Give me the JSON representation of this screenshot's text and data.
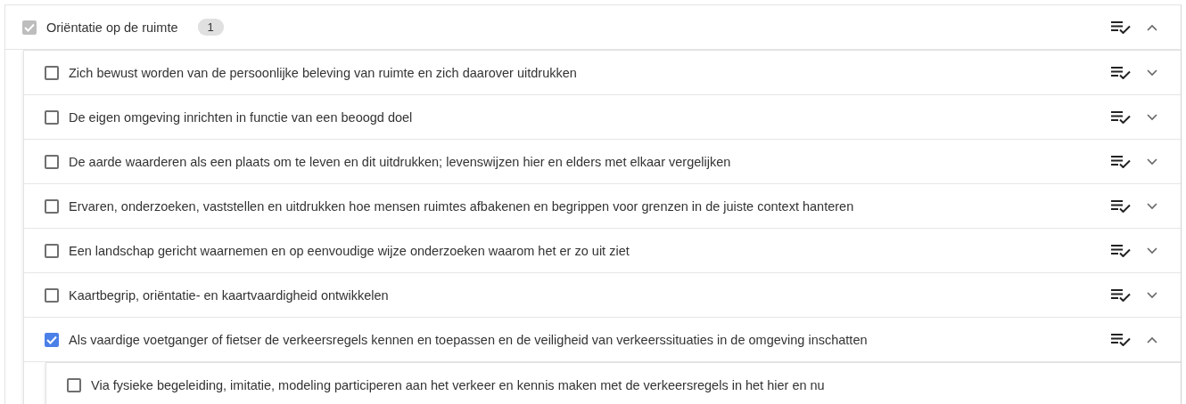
{
  "goals": [
    {
      "label": "Oriëntatie op de ruimte",
      "badge": "1",
      "checked": true,
      "disabled": true,
      "expanded": true,
      "children": [
        {
          "label": "Zich bewust worden van de persoonlijke beleving van ruimte en zich daarover uitdrukken",
          "checked": false,
          "expanded": false
        },
        {
          "label": "De eigen omgeving inrichten in functie van een beoogd doel",
          "checked": false,
          "expanded": false
        },
        {
          "label": "De aarde waarderen als een plaats om te leven en dit uitdrukken; levenswijzen hier en elders met elkaar vergelijken",
          "checked": false,
          "expanded": false
        },
        {
          "label": "Ervaren, onderzoeken, vaststellen en uitdrukken hoe mensen ruimtes afbakenen en begrippen voor grenzen in de juiste context hanteren",
          "checked": false,
          "expanded": false
        },
        {
          "label": "Een landschap gericht waarnemen en op eenvoudige wijze onderzoeken waarom het er zo uit ziet",
          "checked": false,
          "expanded": false
        },
        {
          "label": "Kaartbegrip, oriëntatie- en kaartvaardigheid ontwikkelen",
          "checked": false,
          "expanded": false
        },
        {
          "label": "Als vaardige voetganger of fietser de verkeersregels kennen en toepassen en de veiligheid van verkeerssituaties in de omgeving inschatten",
          "checked": true,
          "expanded": true,
          "children": [
            {
              "label": "Via fysieke begeleiding, imitatie, modeling participeren aan het verkeer en kennis maken met de verkeersregels in het hier en nu",
              "checked": false
            }
          ]
        }
      ]
    }
  ]
}
